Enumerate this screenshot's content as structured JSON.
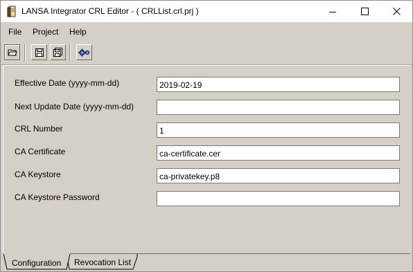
{
  "window": {
    "title": "LANSA Integrator CRL Editor - ( CRLList.crl.prj )"
  },
  "menu": {
    "file": "File",
    "project": "Project",
    "help": "Help"
  },
  "toolbar": {
    "icons": [
      "open-folder-icon",
      "save-icon",
      "save-all-icon",
      "settings-run-icon"
    ]
  },
  "form": {
    "effective_date_label": "Effective Date (yyyy-mm-dd)",
    "effective_date_value": "2019-02-19",
    "next_update_label": "Next Update Date (yyyy-mm-dd)",
    "next_update_value": "",
    "crl_number_label": "CRL Number",
    "crl_number_value": "1",
    "ca_certificate_label": "CA Certificate",
    "ca_certificate_value": "ca-certificate.cer",
    "ca_keystore_label": "CA Keystore",
    "ca_keystore_value": "ca-privatekey.p8",
    "ca_keystore_password_label": "CA Keystore Password",
    "ca_keystore_password_value": ""
  },
  "tabs": {
    "configuration": "Configuration",
    "revocation_list": "Revocation List",
    "active": "Configuration"
  }
}
